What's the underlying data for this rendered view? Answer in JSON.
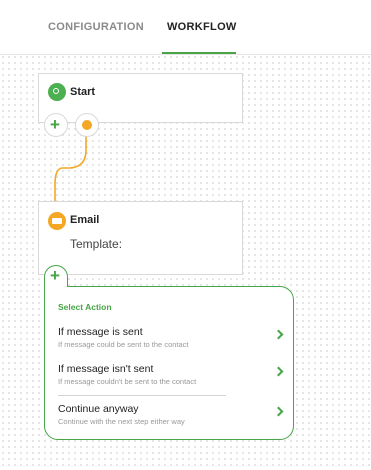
{
  "tabs": [
    {
      "label": "CONFIGURATION",
      "active": false
    },
    {
      "label": "WORKFLOW",
      "active": true
    }
  ],
  "nodes": {
    "start": {
      "title": "Start",
      "icon": "start-icon"
    },
    "email": {
      "title": "Email",
      "template_label": "Template:",
      "icon": "email-icon"
    }
  },
  "action_menu": {
    "title": "Select Action",
    "items": [
      {
        "title": "If message is sent",
        "subtitle": "If message could be sent to the contact"
      },
      {
        "title": "If message isn't sent",
        "subtitle": "If message couldn't be sent to the contact"
      },
      {
        "title": "Continue anyway",
        "subtitle": "Continue with the next step either way"
      }
    ]
  },
  "colors": {
    "accent": "#47a447",
    "connector": "#f5a623",
    "start_icon": "#4caf50"
  }
}
